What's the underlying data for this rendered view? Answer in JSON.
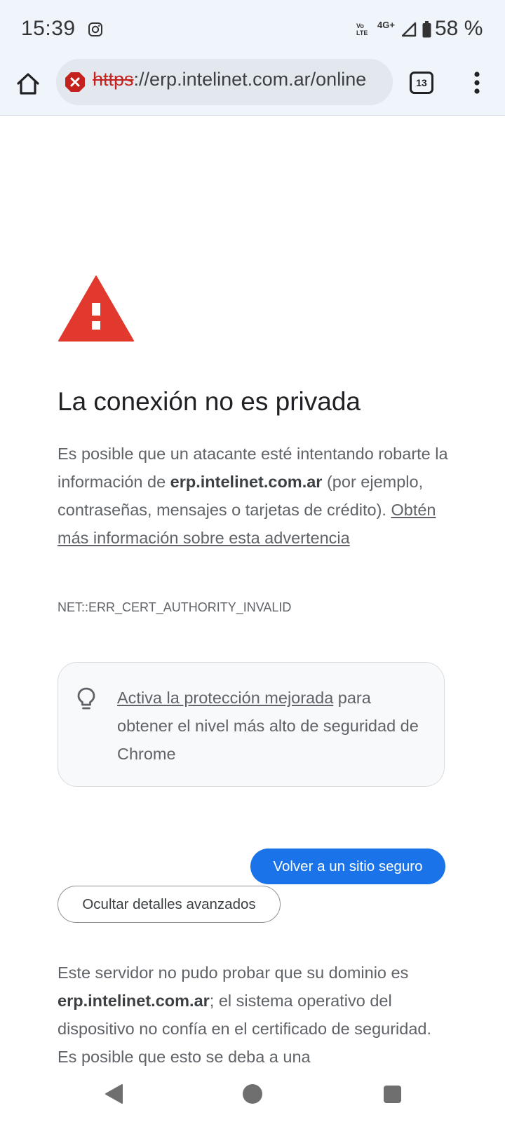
{
  "status_bar": {
    "time": "15:39",
    "volte_line1": "Vo",
    "volte_line2": "LTE",
    "network": "4G+",
    "battery": "58 %",
    "icons": [
      "instagram-icon",
      "signal-icon",
      "battery-icon"
    ]
  },
  "toolbar": {
    "url_scheme": "https",
    "url_rest": "://erp.intelinet.com.ar/online",
    "tab_count": "13",
    "icons": [
      "home-icon",
      "not-secure-icon",
      "tab-switcher-icon",
      "overflow-menu-icon"
    ]
  },
  "interstitial": {
    "heading": "La conexión no es privada",
    "explain_part1": "Es posible que un atacante esté intentando robarte la información de ",
    "explain_domain": "erp.intelinet.com.ar",
    "explain_part2": " (por ejemplo, contraseñas, mensajes o tarjetas de crédito). ",
    "learn_more_link": "Obtén más información sobre esta advertencia",
    "error_code": "NET::ERR_CERT_AUTHORITY_INVALID",
    "tip_link": "Activa la protección mejorada",
    "tip_text": " para obtener el nivel más alto de seguridad de Chrome",
    "back_button": "Volver a un sitio seguro",
    "details_button": "Ocultar detalles avanzados",
    "details_part1": "Este servidor no pudo probar que su dominio es ",
    "details_domain": "erp.intelinet.com.ar",
    "details_part2": "; el sistema operativo del dispositivo no confía en el certificado de seguridad. Es posible que esto se deba a una",
    "icons": [
      "warning-triangle-icon",
      "lightbulb-icon"
    ]
  },
  "nav_bar": {
    "icons": [
      "back-icon",
      "home-circle-icon",
      "recents-icon"
    ]
  },
  "colors": {
    "accent": "#1a73e8",
    "danger": "#c5221f",
    "warning": "#e1392d",
    "chrome_bg": "#f0f4fb"
  }
}
